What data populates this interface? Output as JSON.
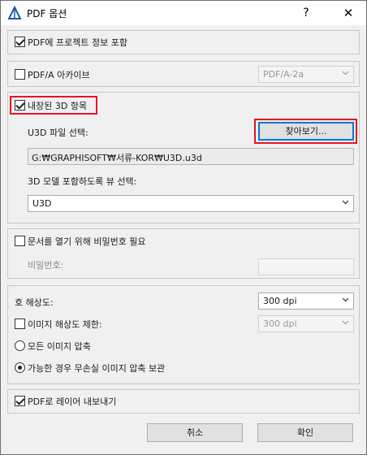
{
  "window": {
    "title": "PDF 옵션",
    "help_label": "?",
    "close_label": "✕"
  },
  "include_project_info": {
    "label": "PDF에 프로젝트 정보 포함",
    "checked": true
  },
  "pdfa": {
    "label": "PDF/A 아카이브",
    "checked": false,
    "select_value": "PDF/A-2a"
  },
  "embedded3d": {
    "label": "내장된 3D 항목",
    "checked": true,
    "u3d_file_label": "U3D 파일 선택:",
    "browse_label": "찾아보기...",
    "file_path": "G:₩GRAPHISOFT₩서류-KOR₩U3D.u3d",
    "view_label": "3D 모델 포함하도록 뷰 선택:",
    "view_select_value": "U3D"
  },
  "password": {
    "label": "문서를 열기 위해 비밀번호 필요",
    "checked": false,
    "password_label": "비밀번호:",
    "password_value": ""
  },
  "resolution": {
    "label": "호 해상도:",
    "select_value": "300 dpi",
    "limit_label": "이미지 해상도 제한:",
    "limit_checked": false,
    "limit_select_value": "300 dpi",
    "compress_all_label": "모든 이미지 압축",
    "compress_lossless_label": "가능한 경우 무손실 이미지 압축 보관",
    "selected_option": "lossless"
  },
  "layers": {
    "label": "PDF로 레이어 내보내기",
    "checked": true
  },
  "footer": {
    "cancel_label": "취소",
    "ok_label": "확인"
  },
  "colors": {
    "highlight_red": "#e81123",
    "default_button_blue": "#0078d7"
  }
}
